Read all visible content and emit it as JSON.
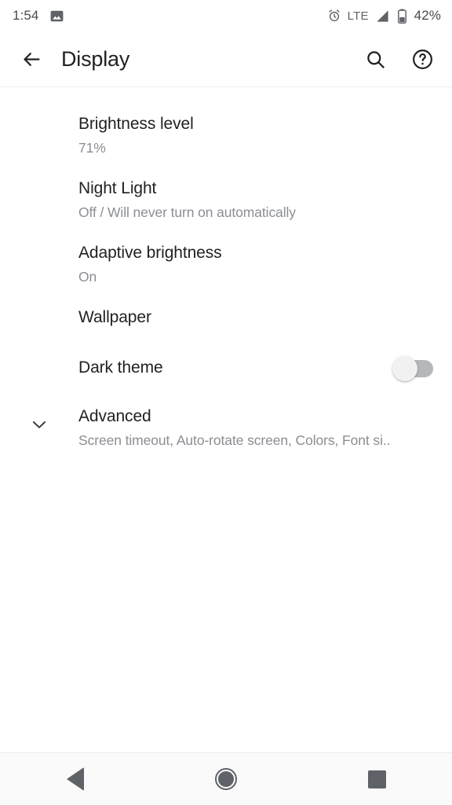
{
  "status_bar": {
    "time": "1:54",
    "left_icons": [
      {
        "name": "photo-icon",
        "label": "photo"
      }
    ],
    "alarm_icon": "alarm-icon",
    "network_type": "LTE",
    "signal_icon": "signal-bars-icon",
    "battery_icon": "battery-icon",
    "battery_percent": "42%"
  },
  "app_bar": {
    "back_icon": "arrow-back-icon",
    "title": "Display",
    "search_icon": "search-icon",
    "help_icon": "help-circle-icon"
  },
  "settings": [
    {
      "key": "brightness",
      "title": "Brightness level",
      "subtitle": "71%",
      "control": "none"
    },
    {
      "key": "nightlight",
      "title": "Night Light",
      "subtitle": "Off / Will never turn on automatically",
      "control": "none"
    },
    {
      "key": "adaptive",
      "title": "Adaptive brightness",
      "subtitle": "On",
      "control": "none"
    },
    {
      "key": "wallpaper",
      "title": "Wallpaper",
      "subtitle": "",
      "control": "none"
    },
    {
      "key": "darktheme",
      "title": "Dark theme",
      "subtitle": "",
      "control": "switch",
      "switch_state": "off"
    },
    {
      "key": "advanced",
      "title": "Advanced",
      "subtitle": "Screen timeout, Auto-rotate screen, Colors, Font si..",
      "control": "none",
      "leading_icon": "chevron-down-icon"
    }
  ],
  "nav_bar": {
    "back": "back-triangle-icon",
    "home": "home-circle-icon",
    "recents": "recents-square-icon"
  },
  "colors": {
    "background": "#ffffff",
    "title_text": "#202124",
    "subtitle_text": "#8b8e93",
    "status_text": "#5f6368",
    "nav_icon": "#5f6368",
    "switch_track_off": "#b5b7ba",
    "switch_thumb_off": "#f1f1f1",
    "divider": "#eceef0",
    "nav_bar_bg": "#fafafa"
  }
}
